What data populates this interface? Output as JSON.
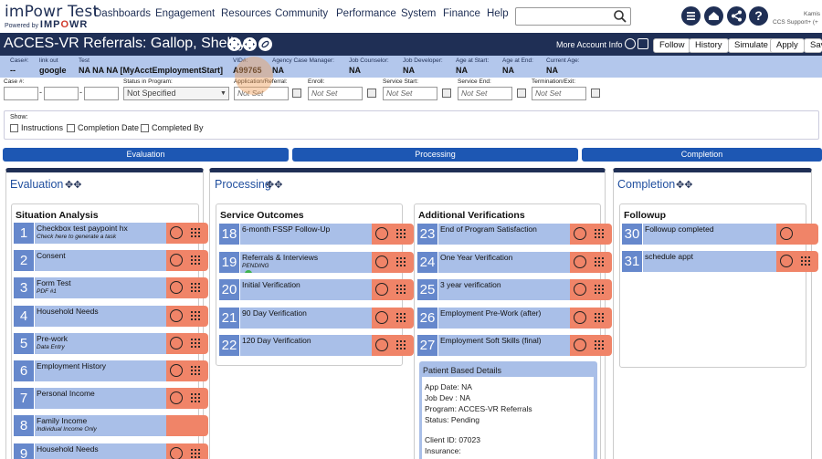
{
  "app": {
    "logo_title": "imPowr Test",
    "logo_powered": "Powered by",
    "logo_brand_a": "IMP",
    "logo_brand_o": "O",
    "logo_brand_b": "WR"
  },
  "nav": [
    "Dashboards",
    "Engagement",
    "Resources",
    "Community",
    "Performance",
    "System",
    "Finance",
    "Help"
  ],
  "search": {
    "placeholder": "",
    "value": ""
  },
  "user": {
    "line1": "Kamis",
    "line2": "CCS Support+ (+"
  },
  "title_bar": {
    "title": "ACCES-VR Referrals: Gallop, Shelby",
    "more_info": "More Account Info",
    "buttons": [
      "Follow",
      "History",
      "Simulate",
      "Apply",
      "Sav"
    ]
  },
  "info": [
    {
      "label": "Case#:",
      "value": "--"
    },
    {
      "label": "link out",
      "value": "google"
    },
    {
      "label": "Test",
      "value": "NA NA NA [MyAcctEmploymentStart]"
    },
    {
      "label": "VID#:",
      "value": "A99765"
    },
    {
      "label": "Agency Case Manager:",
      "value": "NA"
    },
    {
      "label": "Job Counselor:",
      "value": "NA"
    },
    {
      "label": "Job Developer:",
      "value": "NA"
    },
    {
      "label": "Age at Start:",
      "value": "NA"
    },
    {
      "label": "Age at End:",
      "value": "NA"
    },
    {
      "label": "Current Age:",
      "value": "NA"
    }
  ],
  "fields": {
    "case_label": "Case #:",
    "status_label": "Status in Program:",
    "status_value": "Not Specified",
    "app_label": "Application/Referral:",
    "app_value": "Not Set",
    "enroll_label": "Enroll:",
    "enroll_value": "Not Set",
    "svc_start_label": "Service Start:",
    "svc_start_value": "Not Set",
    "svc_end_label": "Service End:",
    "svc_end_value": "Not Set",
    "term_label": "Termination/Exit:",
    "term_value": "Not Set"
  },
  "show": {
    "label": "Show:",
    "options": [
      "Instructions",
      "Completion Date",
      "Completed By"
    ]
  },
  "stages": [
    "Evaluation",
    "Processing",
    "Completion"
  ],
  "columns": {
    "evaluation": {
      "title": "Evaluation",
      "section": "Situation Analysis",
      "tasks": [
        {
          "n": "1",
          "name": "Checkbox test paypoint hx",
          "sub": "Check here to generate a task"
        },
        {
          "n": "2",
          "name": "Consent",
          "sub": ""
        },
        {
          "n": "3",
          "name": "Form Test",
          "sub": "PDF #1"
        },
        {
          "n": "4",
          "name": "Household Needs",
          "sub": ""
        },
        {
          "n": "5",
          "name": "Pre-work",
          "sub": "Data Entry"
        },
        {
          "n": "6",
          "name": "Employment History",
          "sub": ""
        },
        {
          "n": "7",
          "name": "Personal Income",
          "sub": ""
        },
        {
          "n": "8",
          "name": "Family Income",
          "sub": "Individual Income Only"
        },
        {
          "n": "9",
          "name": "Household Needs",
          "sub": ""
        }
      ]
    },
    "processing": {
      "title": "Processing",
      "section1": "Service Outcomes",
      "tasks1": [
        {
          "n": "18",
          "name": "6-month FSSP Follow-Up",
          "sub": ""
        },
        {
          "n": "19",
          "name": "Referrals & Interviews",
          "sub": "PENDING"
        },
        {
          "n": "20",
          "name": "Initial Verification",
          "sub": ""
        },
        {
          "n": "21",
          "name": "90 Day Verification",
          "sub": ""
        },
        {
          "n": "22",
          "name": "120 Day Verification",
          "sub": ""
        }
      ],
      "section2": "Additional Verifications",
      "tasks2": [
        {
          "n": "23",
          "name": "End of Program Satisfaction",
          "sub": ""
        },
        {
          "n": "24",
          "name": "One Year Verification",
          "sub": ""
        },
        {
          "n": "25",
          "name": "3 year verification",
          "sub": ""
        },
        {
          "n": "26",
          "name": "Employment Pre-Work (after)",
          "sub": ""
        },
        {
          "n": "27",
          "name": "Employment Soft Skills (final)",
          "sub": ""
        }
      ],
      "patient": {
        "title": "Patient Based Details",
        "lines": [
          "App Date: NA",
          "Job Dev  : NA",
          "Program:   ACCES-VR Referrals",
          "Status:      Pending",
          "",
          "Client ID:   07023",
          "Insurance:"
        ]
      }
    },
    "completion": {
      "title": "Completion",
      "section": "Followup",
      "tasks": [
        {
          "n": "30",
          "name": "Followup completed",
          "sub": ""
        },
        {
          "n": "31",
          "name": "schedule appt",
          "sub": ""
        }
      ]
    }
  },
  "colors": {
    "navy": "#1f2f55",
    "stage_blue": "#1d57b3",
    "task_blue": "#a9bfe8",
    "task_num": "#6688cc",
    "action_orange": "#f08468",
    "info_strip": "#b3c7ec"
  }
}
